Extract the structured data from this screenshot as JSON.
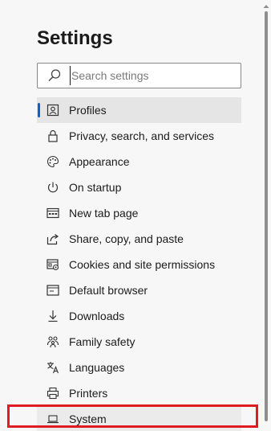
{
  "settings": {
    "title": "Settings",
    "search": {
      "placeholder": "Search settings",
      "value": ""
    },
    "nav": [
      {
        "label": "Profiles",
        "icon": "profile-icon",
        "selected": true
      },
      {
        "label": "Privacy, search, and services",
        "icon": "lock-icon"
      },
      {
        "label": "Appearance",
        "icon": "palette-icon"
      },
      {
        "label": "On startup",
        "icon": "power-icon"
      },
      {
        "label": "New tab page",
        "icon": "new-tab-icon"
      },
      {
        "label": "Share, copy, and paste",
        "icon": "share-icon"
      },
      {
        "label": "Cookies and site permissions",
        "icon": "cookies-icon"
      },
      {
        "label": "Default browser",
        "icon": "browser-icon"
      },
      {
        "label": "Downloads",
        "icon": "download-icon"
      },
      {
        "label": "Family safety",
        "icon": "family-icon"
      },
      {
        "label": "Languages",
        "icon": "language-icon"
      },
      {
        "label": "Printers",
        "icon": "printer-icon"
      },
      {
        "label": "System",
        "icon": "laptop-icon"
      }
    ]
  },
  "colors": {
    "accent": "#0a63c8",
    "highlight": "#e01b24",
    "selected_bg": "#e5e5e5"
  }
}
